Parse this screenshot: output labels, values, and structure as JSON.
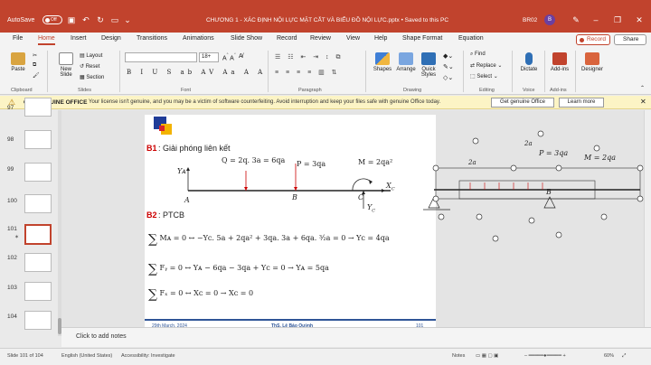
{
  "titlebar": {
    "autosave_label": "AutoSave",
    "autosave_state": "Off",
    "document_title": "CHƯƠNG 1 - XÁC ĐỊNH NỘI LỰC MẶT CẮT VÀ BIỂU ĐỒ NỘI LỰC.pptx  •  Saved to this PC",
    "user_name": "BR02",
    "avatar_initial": "B"
  },
  "tabs": [
    "File",
    "Home",
    "Insert",
    "Design",
    "Transitions",
    "Animations",
    "Slide Show",
    "Record",
    "Review",
    "View",
    "Help",
    "Shape Format",
    "Equation"
  ],
  "active_tab": "Home",
  "record_button": "Record",
  "share_button": "Share",
  "ribbon": {
    "paste": "Paste",
    "new_slide": "New Slide",
    "layout": "Layout",
    "reset": "Reset",
    "section": "Section",
    "font_size": "18+",
    "find": "Find",
    "replace": "Replace",
    "select": "Select",
    "shapes": "Shapes",
    "arrange": "Arrange",
    "quick_styles": "Quick Styles",
    "dictate": "Dictate",
    "addins": "Add-ins",
    "designer": "Designer",
    "groups": {
      "clipboard": "Clipboard",
      "slides": "Slides",
      "font": "Font",
      "paragraph": "Paragraph",
      "drawing": "Drawing",
      "editing": "Editing",
      "voice": "Voice",
      "addins": "Add-ins"
    }
  },
  "warning": {
    "title": "GET GENUINE OFFICE",
    "message": "Your license isn't genuine, and you may be a victim of software counterfeiting. Avoid interruption and keep your files safe with genuine Office today.",
    "primary_button": "Get genuine Office",
    "secondary_button": "Learn more"
  },
  "thumbnails": [
    "97",
    "98",
    "99",
    "100",
    "101",
    "102",
    "103",
    "104"
  ],
  "active_slide": "101",
  "slide": {
    "b1_label": "B1",
    "b1_text": ": Giải phóng liên kết",
    "b2_label": "B2",
    "b2_text": ": PTCB",
    "load_q": "Q = 2q. 3a = 6qa",
    "load_p": "P = 3qa",
    "moment": "M = 2qa²",
    "point_a": "A",
    "point_b": "B",
    "point_c": "C",
    "ya": "Yᴀ",
    "xc": "X",
    "xc_sub": "C",
    "yc": "Y",
    "yc_sub": "C",
    "eq1": "Mᴀ = 0 ↔ −Yᴄ. 5a + 2qa² + 3qa. 3a + 6qa. ³⁄₂a = 0 → Yᴄ = 4qa",
    "eq2": "Fᵧ = 0 ↔ Yᴀ − 6qa − 3qa + Yᴄ = 0 → Yᴀ = 5qa",
    "eq3": "Fₓ = 0 ↔ Xᴄ = 0 → Xᴄ = 0",
    "footer_date": "29th March, 2024",
    "footer_author": "ThS. Lê Bảo Quỳnh",
    "footer_page": "101"
  },
  "offslide": {
    "label_2a_top": "2a",
    "label_p": "P = 3qa",
    "label_m": "M = 2qa",
    "label_2a_left": "2a",
    "label_b": "B"
  },
  "notes_placeholder": "Click to add notes",
  "status": {
    "slide_info": "Slide 101 of 104",
    "language": "English (United States)",
    "accessibility": "Accessibility: Investigate",
    "notes": "Notes",
    "zoom": "60%"
  }
}
